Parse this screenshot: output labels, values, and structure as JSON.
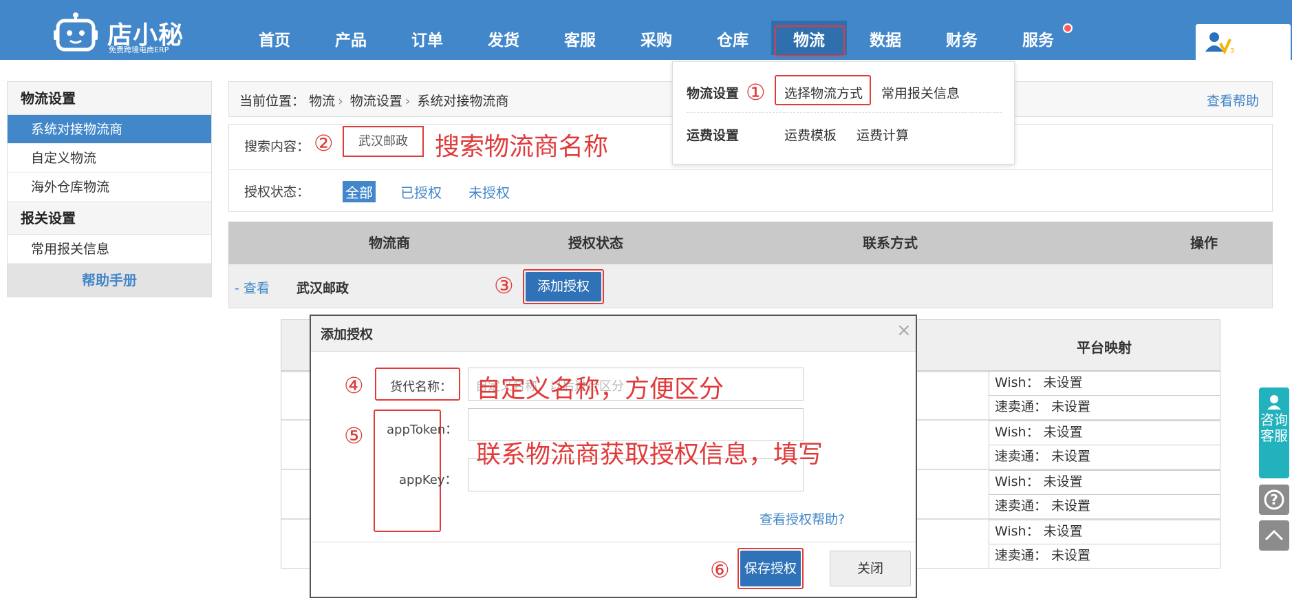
{
  "brand": {
    "name": "店小秘",
    "tagline": "免费跨境电商ERP"
  },
  "nav": [
    "首页",
    "产品",
    "订单",
    "发货",
    "客服",
    "采购",
    "仓库",
    "物流",
    "数据",
    "财务",
    "服务"
  ],
  "nav_active": "物流",
  "sidebar": {
    "group1": "物流设置",
    "items1": [
      "系统对接物流商",
      "自定义物流",
      "海外仓库物流"
    ],
    "group2": "报关设置",
    "items2": [
      "常用报关信息"
    ],
    "help": "帮助手册"
  },
  "breadcrumb": {
    "prefix": "当前位置：",
    "l1": "物流",
    "l2": "物流设置",
    "l3": "系统对接物流商"
  },
  "help_link": "查看帮助",
  "search": {
    "label": "搜索内容：",
    "value": "武汉邮政",
    "annotation": "搜索物流商名称"
  },
  "auth_filter": {
    "label": "授权状态：",
    "all": "全部",
    "authorized": "已授权",
    "unauthorized": "未授权"
  },
  "table": {
    "headers": [
      "物流商",
      "授权状态",
      "联系方式",
      "操作"
    ],
    "row": {
      "view": "- 查看",
      "name": "武汉邮政",
      "action": "添加授权"
    }
  },
  "dropdown": {
    "g1_title": "物流设置",
    "g1_a": "选择物流方式",
    "g1_b": "常用报关信息",
    "g2_title": "运费设置",
    "g2_a": "运费模板",
    "g2_b": "运费计算"
  },
  "back_table": {
    "header": "平台映射",
    "rows": [
      [
        "Wish：  未设置",
        "速卖通：  未设置"
      ],
      [
        "Wish：  未设置",
        "速卖通：  未设置"
      ],
      [
        "Wish：  未设置",
        "速卖通：  未设置"
      ],
      [
        "Wish：  未设置",
        "速卖通：  未设置"
      ]
    ]
  },
  "modal": {
    "title": "添加授权",
    "close": "×",
    "field_name": "货代名称：",
    "field_token": "appToken：",
    "field_key": "appKey：",
    "placeholder_name": "自定义名称，以后进行区分",
    "help": "查看授权帮助?",
    "save": "保存授权",
    "cancel": "关闭"
  },
  "annotations": {
    "n1": "①",
    "n2": "②",
    "n3": "③",
    "n4": "④",
    "n5": "⑤",
    "n6": "⑥",
    "name_hint": "自定义名称，方便区分",
    "auth_hint": "联系物流商获取授权信息，填写"
  },
  "float": {
    "cs": "咨询客服"
  },
  "colors": {
    "primary": "#4287c9",
    "annotation": "#e03b3b",
    "cs": "#21b2bd"
  }
}
